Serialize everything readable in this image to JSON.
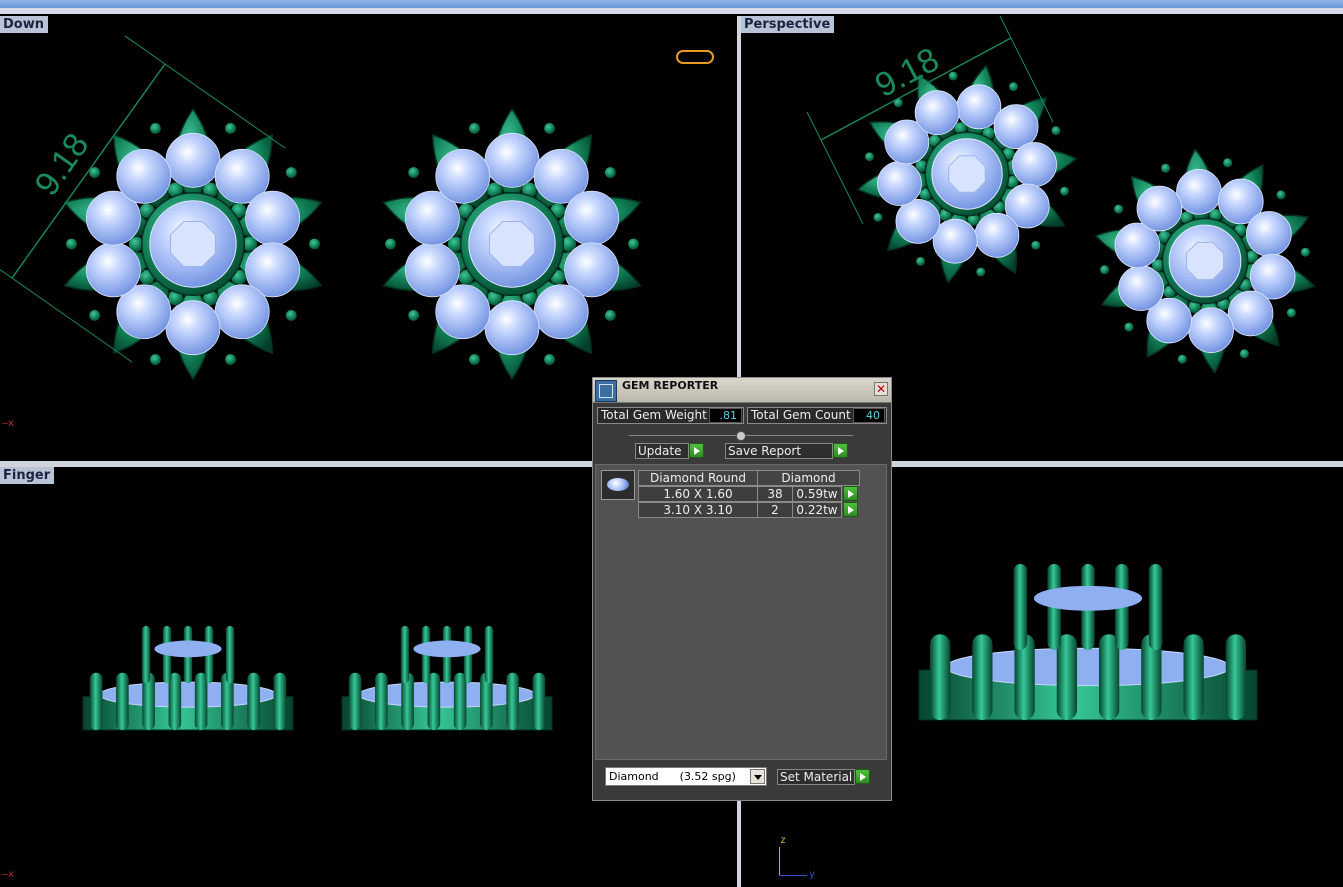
{
  "viewports": {
    "down": {
      "label": "Down",
      "dimension": "9.18",
      "axis_x": "x"
    },
    "perspective": {
      "label": "Perspective",
      "dimension": "9.18"
    },
    "finger": {
      "label": "Finger",
      "axis_x": "x"
    },
    "front": {
      "axis_z": "z",
      "axis_y": "y"
    }
  },
  "dialog": {
    "title": "GEM REPORTER",
    "total_weight_label": "Total Gem Weight",
    "total_weight_value": ".81",
    "total_count_label": "Total Gem Count",
    "total_count_value": "40",
    "update_label": "Update",
    "save_report_label": "Save Report",
    "table": {
      "headers": [
        "Diamond Round",
        "Diamond"
      ],
      "rows": [
        {
          "size": "1.60 X 1.60",
          "count": "38",
          "weight": "0.59tw"
        },
        {
          "size": "3.10 X 3.10",
          "count": "2",
          "weight": "0.22tw"
        }
      ]
    },
    "material_select": "Diamond      (3.52 spg)",
    "set_material_label": "Set Material"
  },
  "colors": {
    "metal": "#0f6a4a",
    "gem": "#8fb0f0",
    "dimension": "#1a8a5a"
  }
}
